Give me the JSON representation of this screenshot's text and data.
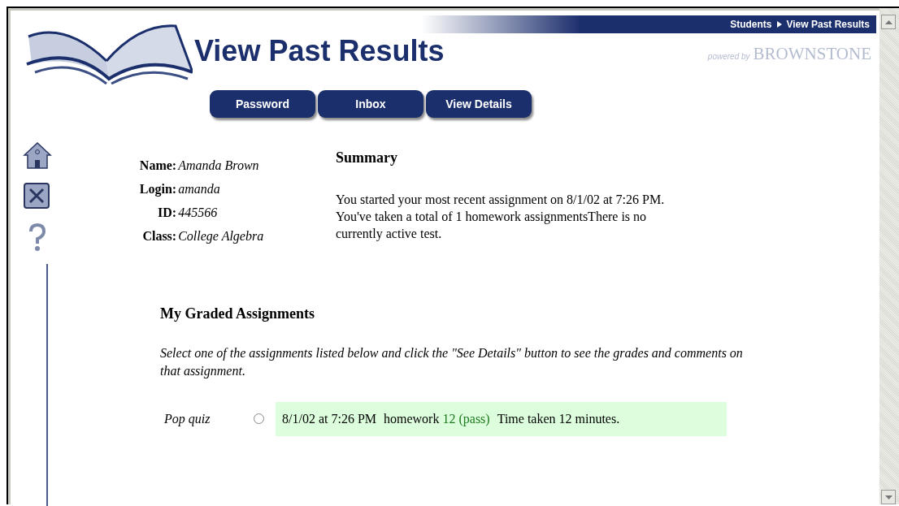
{
  "breadcrumb": {
    "items": [
      "Students",
      "View Past Results"
    ]
  },
  "page_title": "View Past Results",
  "powered_by": {
    "prefix": "powered by",
    "brand": "BROWNSTONE"
  },
  "nav_buttons": [
    "Password",
    "Inbox",
    "View Details"
  ],
  "sidebar_icons": [
    {
      "kind": "home"
    },
    {
      "kind": "close"
    },
    {
      "kind": "help"
    }
  ],
  "profile": [
    {
      "label": "Name:",
      "value": "Amanda Brown"
    },
    {
      "label": "Login:",
      "value": "amanda"
    },
    {
      "label": "ID:",
      "value": "445566"
    },
    {
      "label": "Class:",
      "value": "College Algebra"
    }
  ],
  "summary": {
    "heading": "Summary",
    "text": "You started your most recent assignment on 8/1/02 at 7:26 PM. You've taken a total of 1 homework assignmentsThere is no currently active test."
  },
  "graded": {
    "heading": "My Graded Assignments",
    "instructions": "Select one of the assignments listed below and click the \"See Details\" button to see the grades and comments on that assignment.",
    "rows": [
      {
        "name": "Pop quiz",
        "selected": false,
        "date": "8/1/02 at 7:26 PM",
        "type": "homework",
        "score": "12 (pass)",
        "time": "Time taken 12 minutes."
      }
    ]
  }
}
